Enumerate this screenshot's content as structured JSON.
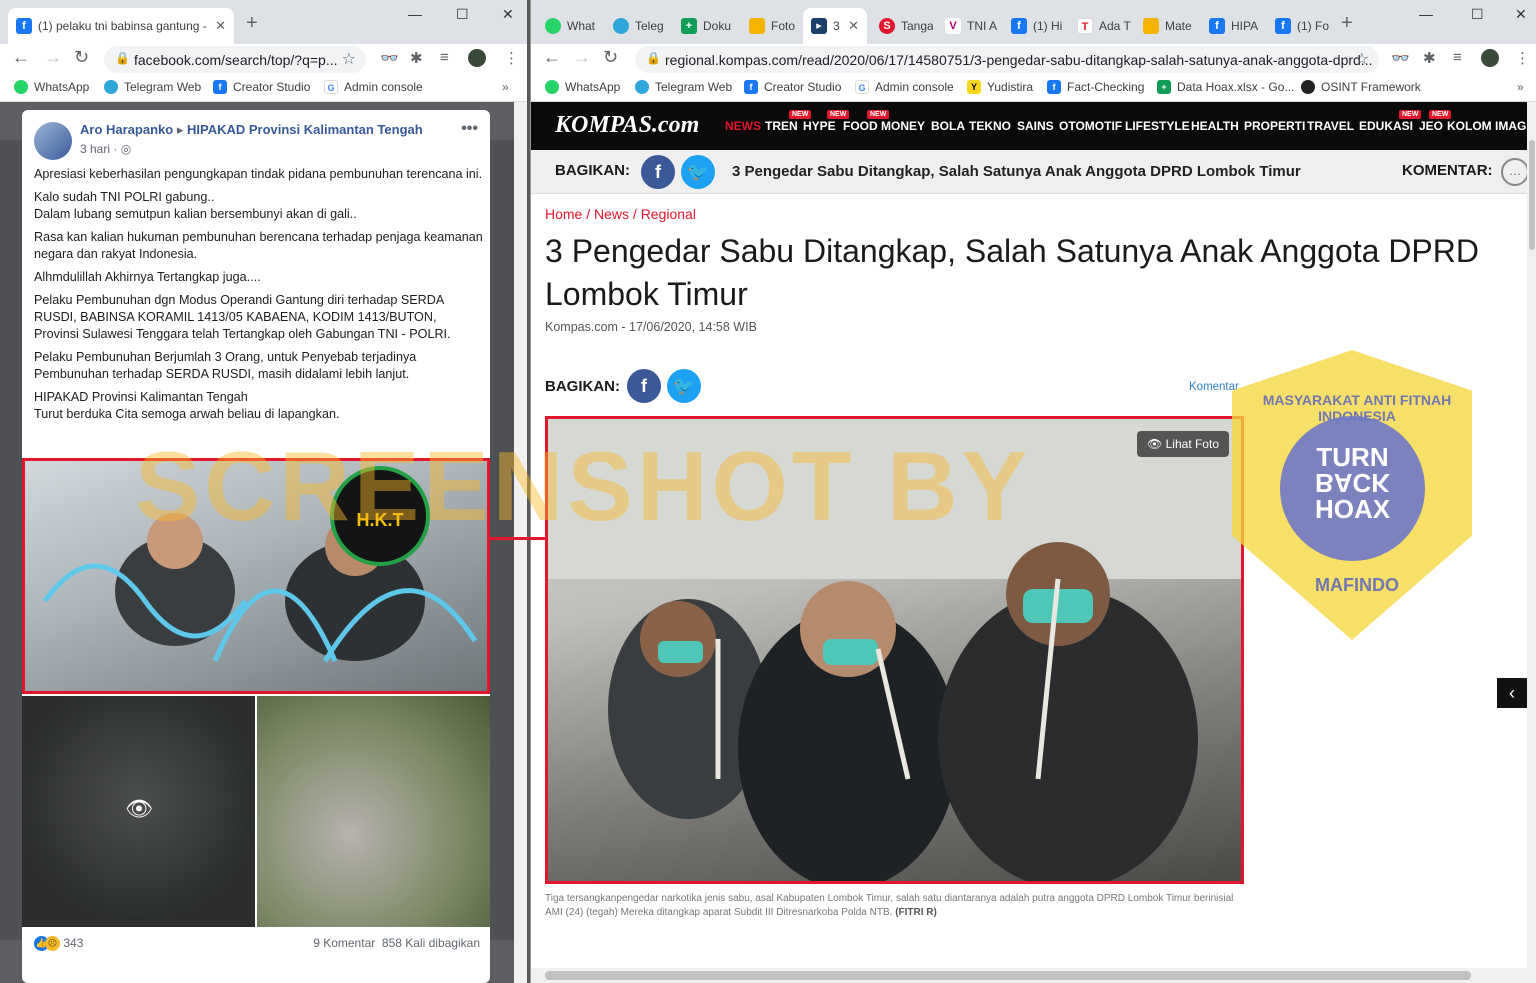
{
  "left": {
    "tab": {
      "title": "(1) pelaku tni babinsa gantung -"
    },
    "omnibox": {
      "url": "facebook.com/search/top/?q=p..."
    },
    "bookmarks": [
      "WhatsApp",
      "Telegram Web",
      "Creator Studio",
      "Admin console"
    ],
    "post": {
      "author": "Aro Harapanko",
      "group": "HIPAKAD Provinsi Kalimantan Tengah",
      "time": "3 hari",
      "paragraphs": [
        "Apresiasi keberhasilan pengungkapan tindak pidana pembunuhan terencana ini.",
        "Kalo sudah TNI POLRI gabung..\nDalam lubang semutpun kalian bersembunyi akan di gali..",
        "Rasa kan kalian hukuman pembunuhan berencana terhadap penjaga keamanan negara dan rakyat Indonesia.",
        "Alhmdulillah Akhirnya Tertangkap juga....",
        "Pelaku Pembunuhan dgn Modus Operandi Gantung diri terhadap SERDA RUSDI, BABINSA KORAMIL 1413/05 KABAENA, KODIM 1413/BUTON, Provinsi Sulawesi Tenggara telah Tertangkap oleh Gabungan TNI - POLRI.",
        "Pelaku Pembunuhan Berjumlah 3 Orang, untuk Penyebab terjadinya Pembunuhan terhadap SERDA RUSDI, masih didalami lebih lanjut.",
        "HIPAKAD Provinsi Kalimantan Tengah\nTurut berduka Cita semoga arwah beliau di lapangkan."
      ],
      "logo_text": "H.K.T",
      "reaction_count": "343",
      "comments": "9 Komentar",
      "shares": "858 Kali dibagikan"
    }
  },
  "right": {
    "tabs": [
      "What",
      "Teleg",
      "Doku",
      "Foto",
      "3",
      "Tanga",
      "TNI A",
      "(1) Hi",
      "Ada T",
      "Mate",
      "HIPA",
      "(1) Fo"
    ],
    "omnibox": {
      "url": "regional.kompas.com/read/2020/06/17/14580751/3-pengedar-sabu-ditangkap-salah-satunya-anak-anggota-dprd..."
    },
    "bookmarks": [
      "WhatsApp",
      "Telegram Web",
      "Creator Studio",
      "Admin console",
      "Yudistira",
      "Fact-Checking",
      "Data Hoax.xlsx - Go...",
      "OSINT Framework"
    ],
    "site": {
      "logo": "KOMPAS.com",
      "menu": [
        "NEWS",
        "TREN",
        "HYPE",
        "FOOD",
        "MONEY",
        "BOLA",
        "TEKNO",
        "SAINS",
        "OTOMOTIF",
        "LIFESTYLE",
        "HEALTH",
        "PROPERTI",
        "TRAVEL",
        "EDUKASI",
        "JEO",
        "KOLOM",
        "IMAGE"
      ],
      "new_badge": "NEW",
      "share_label": "BAGIKAN:",
      "share_title": "3 Pengedar Sabu Ditangkap, Salah Satunya Anak Anggota DPRD Lombok Timur",
      "comment_label": "KOMENTAR:"
    },
    "article": {
      "breadcrumb": "Home / News / Regional",
      "title": "3 Pengedar Sabu Ditangkap, Salah Satunya Anak Anggota DPRD Lombok Timur",
      "meta": "Kompas.com - 17/06/2020, 14:58 WIB",
      "share_label": "BAGIKAN:",
      "komentar": "Komentar",
      "lihat_foto": "Lihat Foto",
      "caption": "Tiga tersangkanpengedar narkotika jenis sabu, asal Kabupaten Lombok Timur, salah satu diantaranya adalah putra anggota DPRD Lombok Timur berinisial AMI (24) (tegah) Mereka ditangkap aparat Subdit III Ditresnarkoba Polda NTB.",
      "caption_credit": "(FITRI R)"
    }
  },
  "overlay": {
    "watermark": "SCREENSHOT BY",
    "badge_top": "MASYARAKAT ANTI FITNAH INDONESIA",
    "badge_center": [
      "TURN",
      "BACK",
      "HOAX"
    ],
    "badge_bottom": "MAFINDO"
  },
  "colors": {
    "facebook": "#385898",
    "kompas_red": "#e2172c",
    "highlight_border": "#e2172c",
    "twitter": "#1da1f2"
  }
}
